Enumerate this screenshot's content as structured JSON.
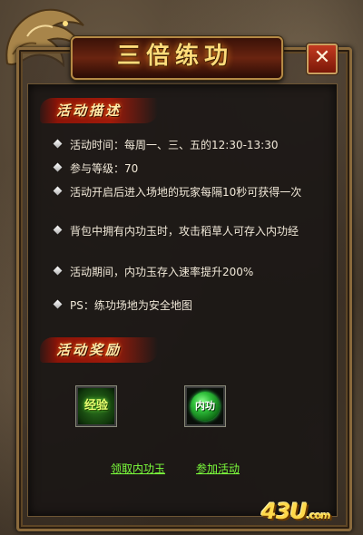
{
  "window": {
    "title": "三倍练功",
    "close_glyph": "✕"
  },
  "sections": {
    "description_header": "活动描述",
    "rewards_header": "活动奖励"
  },
  "description_lines": [
    "活动时间：每周一、三、五的12:30-13:30",
    "参与等级：70",
    "活动开启后进入场地的玩家每隔10秒可获得一次",
    "背包中拥有内功玉时，攻击稻草人可存入内功经",
    "活动期间，内功玉存入速率提升200%",
    "PS：练功场地为安全地图"
  ],
  "rewards": {
    "exp_label": "经验",
    "neigong_label": "内功"
  },
  "actions": {
    "claim_link": "领取内功玉",
    "join_link": "参加活动"
  },
  "watermark": {
    "text": "43U",
    "suffix": ".com"
  },
  "colors": {
    "title_gold": "#ffdc7a",
    "link_green": "#7cff3c",
    "header_red": "#a01a0a"
  }
}
